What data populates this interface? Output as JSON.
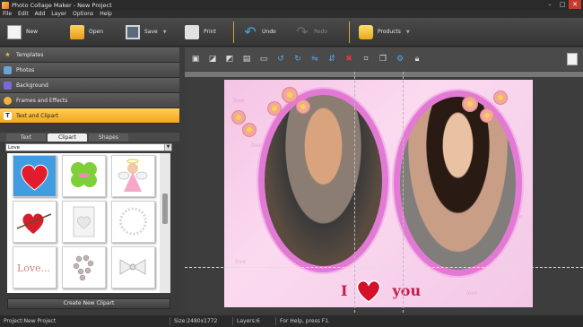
{
  "window": {
    "title": "Photo Collage Maker - New Project"
  },
  "menu": [
    "File",
    "Edit",
    "Add",
    "Layer",
    "Options",
    "Help"
  ],
  "toolbar": {
    "new": "New",
    "open": "Open",
    "save": "Save",
    "print": "Print",
    "undo": "Undo",
    "redo": "Redo",
    "products": "Products"
  },
  "panel": {
    "sections": [
      "Templates",
      "Photos",
      "Background",
      "Frames and Effects",
      "Text and Clipart"
    ],
    "active_section": "Text and Clipart",
    "tabs": [
      "Text",
      "Clipart",
      "Shapes"
    ],
    "selected_tab": "Clipart",
    "category": "Love",
    "create_button": "Create New Clipart",
    "cliparts": [
      "heart",
      "clover",
      "angel",
      "heart-arrow",
      "heart-card",
      "ring",
      "love-text",
      "pearls",
      "bow"
    ]
  },
  "canvas": {
    "caption_left": "I",
    "caption_right": "you",
    "background_word": "love"
  },
  "status": {
    "project": "Project:New Project",
    "size": "Size:2480x1772",
    "layers": "Layers:6",
    "help": "For Help, press F1."
  },
  "colors": {
    "accent": "#f2a51c",
    "frame": "#e27ad4",
    "caption": "#c81b4b"
  }
}
